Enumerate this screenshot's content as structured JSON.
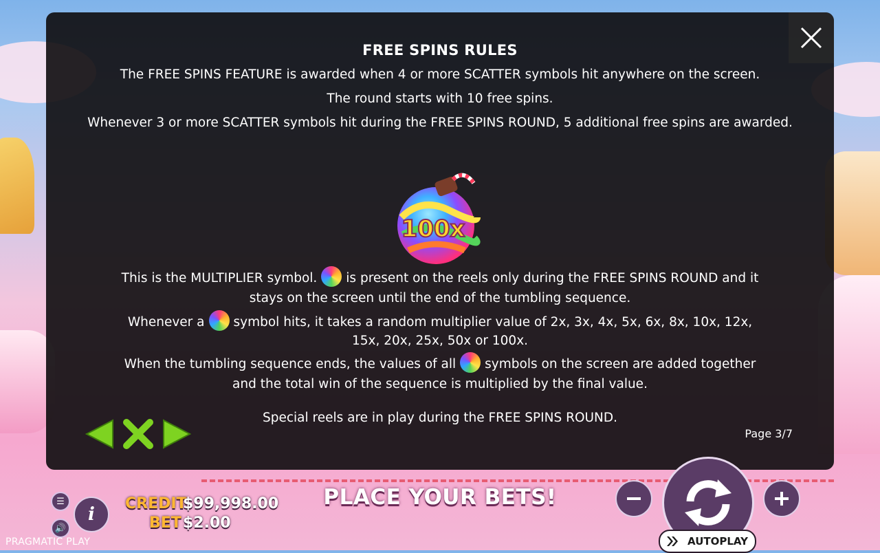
{
  "modal": {
    "title": "FREE SPINS RULES",
    "line1": "The FREE SPINS FEATURE is awarded when 4 or more SCATTER symbols hit anywhere on the screen.",
    "line2": "The round starts with 10 free spins.",
    "line3": "Whenever 3 or more SCATTER symbols hit during the FREE SPINS ROUND, 5 additional free spins are awarded.",
    "symbol_label": "100x",
    "p1a": "This is the MULTIPLIER symbol.",
    "p1b": "is present on the reels only during the FREE SPINS ROUND and it stays on the screen until the end of the tumbling sequence.",
    "p2a": "Whenever a",
    "p2b": "symbol hits, it takes a random multiplier value of 2x, 3x, 4x, 5x, 6x, 8x, 10x, 12x, 15x, 20x, 25x, 50x or 100x.",
    "p3a": "When the tumbling sequence ends, the values of all",
    "p3b": "symbols on the screen are added together and the total win of the sequence is multiplied by the final value.",
    "p4": "Special reels are in play during the FREE SPINS ROUND.",
    "page_indicator": "Page 3/7"
  },
  "bottom_bar": {
    "credit_label": "CREDIT",
    "credit_value": "$99,998.00",
    "bet_label": "BET",
    "bet_value": "$2.00",
    "message": "PLACE YOUR BETS!",
    "autoplay_label": "AUTOPLAY",
    "brand": "PRAGMATIC PLAY"
  },
  "colors": {
    "nav_green": "#7ed321",
    "label_orange": "#ffb733"
  },
  "icons": [
    "close-icon",
    "prev-arrow-icon",
    "close-rules-icon",
    "next-arrow-icon",
    "menu-icon",
    "sound-icon",
    "info-icon",
    "minus-icon",
    "plus-icon",
    "spin-icon",
    "autoplay-icon",
    "multiplier-bomb-icon"
  ]
}
